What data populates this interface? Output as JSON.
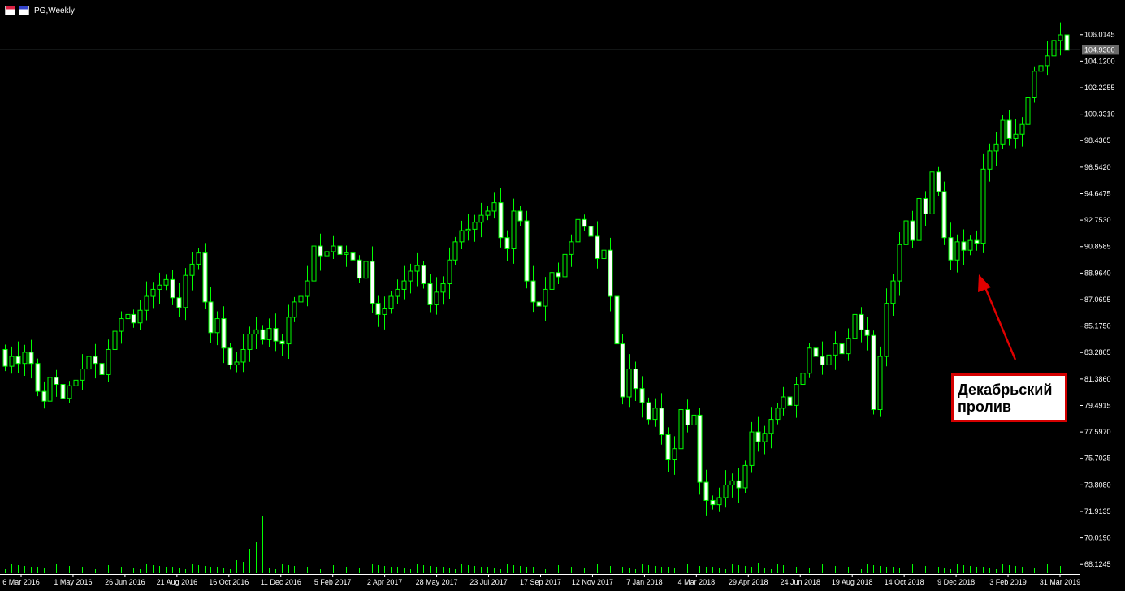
{
  "window": {
    "title": "PG,Weekly",
    "icons": [
      "chart-window-icon",
      "chart-properties-icon"
    ]
  },
  "annotation": {
    "text": "Декабрьский\nпролив",
    "border_color": "#d40000",
    "arrow_color": "#e00000"
  },
  "colors": {
    "background": "#000000",
    "bull_fill": "#000000",
    "bear_fill": "#ffffff",
    "wick": "#00ff00",
    "axis_text": "#ffffff",
    "price_line": "#8fa8a8",
    "current_price_bg": "#6a6a6a"
  },
  "current_price": "104.9300",
  "chart_data": {
    "type": "candlestick",
    "symbol": "PG",
    "timeframe": "Weekly",
    "ylim": [
      67.5,
      107.8
    ],
    "price_ticks": [
      "106.0145",
      "104.1200",
      "102.2255",
      "100.3310",
      "98.4365",
      "96.5420",
      "94.6475",
      "92.7530",
      "90.8585",
      "88.9640",
      "87.0695",
      "85.1750",
      "83.2805",
      "81.3860",
      "79.4915",
      "77.5970",
      "75.7025",
      "73.8080",
      "71.9135",
      "70.0190",
      "68.1245"
    ],
    "date_ticks": [
      "6 Mar 2016",
      "1 May 2016",
      "26 Jun 2016",
      "21 Aug 2016",
      "16 Oct 2016",
      "11 Dec 2016",
      "5 Feb 2017",
      "2 Apr 2017",
      "28 May 2017",
      "23 Jul 2017",
      "17 Sep 2017",
      "12 Nov 2017",
      "7 Jan 2018",
      "4 Mar 2018",
      "29 Apr 2018",
      "24 Jun 2018",
      "19 Aug 2018",
      "14 Oct 2018",
      "9 Dec 2018",
      "3 Feb 2019",
      "31 Mar 2019"
    ],
    "closes": [
      82.3,
      83.0,
      82.5,
      83.3,
      82.5,
      80.5,
      79.8,
      81.5,
      81.0,
      80.0,
      80.9,
      81.3,
      82.1,
      83.0,
      82.5,
      81.7,
      83.5,
      84.8,
      85.7,
      86.0,
      85.4,
      86.3,
      87.3,
      87.8,
      88.1,
      88.5,
      87.2,
      86.5,
      88.8,
      89.6,
      90.4,
      86.9,
      84.7,
      85.7,
      83.6,
      82.4,
      82.6,
      83.5,
      84.6,
      84.9,
      84.2,
      85.0,
      84.1,
      83.9,
      85.8,
      86.9,
      87.3,
      88.4,
      90.9,
      90.2,
      90.5,
      90.9,
      90.3,
      90.4,
      89.9,
      88.6,
      89.8,
      86.8,
      86.0,
      86.4,
      87.3,
      87.8,
      88.4,
      89.1,
      89.5,
      88.2,
      86.7,
      87.6,
      88.2,
      89.9,
      91.2,
      92.0,
      92.1,
      92.6,
      93.1,
      93.4,
      94.0,
      91.5,
      90.7,
      93.4,
      92.7,
      88.4,
      86.9,
      86.6,
      87.8,
      89.0,
      88.7,
      90.3,
      91.2,
      92.8,
      92.3,
      91.6,
      90.0,
      90.6,
      87.3,
      83.9,
      80.1,
      82.1,
      80.7,
      79.7,
      78.5,
      79.3,
      77.4,
      75.6,
      76.4,
      79.2,
      78.1,
      78.8,
      74.0,
      72.7,
      72.4,
      72.9,
      73.8,
      74.1,
      73.6,
      75.2,
      77.6,
      76.9,
      77.5,
      78.5,
      79.3,
      80.1,
      79.5,
      81.0,
      81.8,
      83.6,
      83.0,
      82.4,
      83.1,
      83.9,
      83.2,
      84.3,
      86.0,
      84.9,
      84.5,
      79.2,
      83.0,
      86.8,
      88.4,
      91.0,
      92.7,
      91.3,
      94.3,
      93.2,
      96.2,
      94.8,
      91.5,
      89.9,
      91.2,
      90.6,
      91.3,
      91.1,
      96.4,
      97.7,
      98.2,
      99.9,
      98.6,
      98.9,
      99.6,
      101.5,
      103.4,
      103.8,
      104.5,
      105.6,
      106.0,
      104.9
    ],
    "opens": [
      83.5,
      82.3,
      83.0,
      82.5,
      83.3,
      82.5,
      80.5,
      79.8,
      81.5,
      81.0,
      80.0,
      80.9,
      81.3,
      82.1,
      83.0,
      82.5,
      81.7,
      83.5,
      84.8,
      85.7,
      86.0,
      85.4,
      86.3,
      87.3,
      87.8,
      88.1,
      88.5,
      87.2,
      86.5,
      88.8,
      89.6,
      90.4,
      86.9,
      84.7,
      85.7,
      83.6,
      82.4,
      82.6,
      83.5,
      84.6,
      84.9,
      84.2,
      85.0,
      84.1,
      83.9,
      85.8,
      86.9,
      87.3,
      88.4,
      90.9,
      90.2,
      90.5,
      90.9,
      90.3,
      90.4,
      89.9,
      88.6,
      89.8,
      86.8,
      86.0,
      86.4,
      87.3,
      87.8,
      88.4,
      89.1,
      89.5,
      88.2,
      86.7,
      87.6,
      88.2,
      89.9,
      91.2,
      92.0,
      92.1,
      92.6,
      93.1,
      93.4,
      94.0,
      91.5,
      90.7,
      93.4,
      92.7,
      88.4,
      86.9,
      86.6,
      87.8,
      89.0,
      88.7,
      90.3,
      91.2,
      92.8,
      92.3,
      91.6,
      90.0,
      90.6,
      87.3,
      83.9,
      80.1,
      82.1,
      80.7,
      79.7,
      78.5,
      79.3,
      77.4,
      75.6,
      76.4,
      79.2,
      78.1,
      78.8,
      74.0,
      72.7,
      72.4,
      72.9,
      73.8,
      74.1,
      73.6,
      75.2,
      77.6,
      76.9,
      77.5,
      78.5,
      79.3,
      80.1,
      79.5,
      81.0,
      81.8,
      83.6,
      83.0,
      82.4,
      83.1,
      83.9,
      83.2,
      84.3,
      86.0,
      84.9,
      84.5,
      79.2,
      83.0,
      86.8,
      88.4,
      91.0,
      92.7,
      91.3,
      94.3,
      93.2,
      96.2,
      94.8,
      91.5,
      89.9,
      91.2,
      90.6,
      91.3,
      91.1,
      96.4,
      97.7,
      98.2,
      99.9,
      98.6,
      98.9,
      99.6,
      101.5,
      103.4,
      103.8,
      104.5,
      105.6,
      106.0
    ]
  }
}
